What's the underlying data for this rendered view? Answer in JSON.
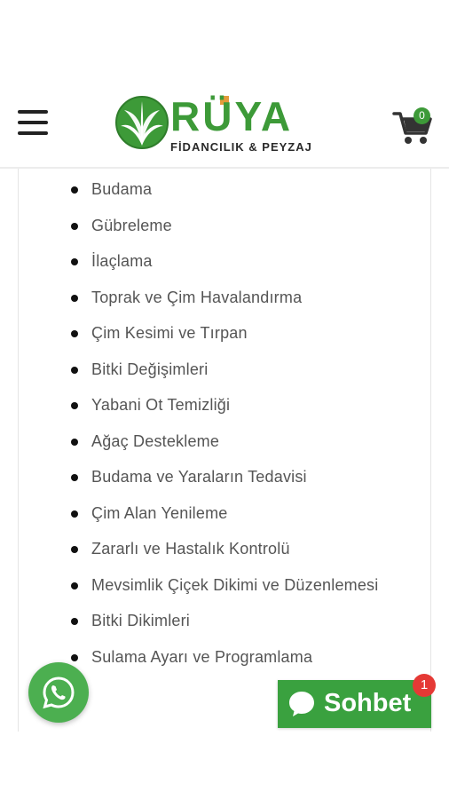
{
  "header": {
    "brand_name": "RÜYA",
    "brand_tagline": "FİDANCILIK & PEYZAJ",
    "cart_count": "0",
    "colors": {
      "brand_green": "#3d9a38",
      "accent_orange": "#e39b3b"
    }
  },
  "services": [
    "Budama",
    "Gübreleme",
    "İlaçlama",
    "Toprak ve Çim Havalandırma",
    "Çim Kesimi ve Tırpan",
    "Bitki Değişimleri",
    "Yabani Ot Temizliği",
    "Ağaç Destekleme",
    "Budama ve Yaraların Tedavisi",
    "Çim Alan Yenileme",
    "Zararlı ve Hastalık Kontrolü",
    "Mevsimlik Çiçek Dikimi ve Düzenlemesi",
    "Bitki Dikimleri",
    "Sulama Ayarı ve Programlama"
  ],
  "chat": {
    "label": "Sohbet",
    "badge": "1",
    "color": "#3aa13f"
  },
  "icons": {
    "menu": "hamburger-icon",
    "cart": "cart-icon",
    "whatsapp": "whatsapp-icon",
    "chat": "chat-bubble-icon"
  }
}
